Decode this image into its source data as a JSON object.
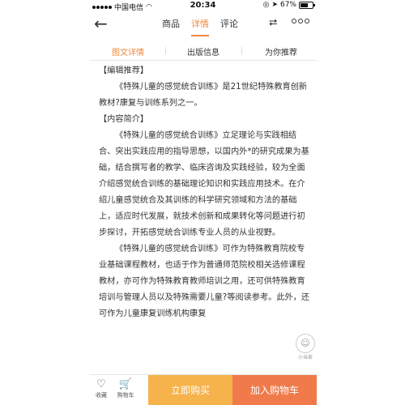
{
  "status_bar": {
    "carrier": "中国电信",
    "time": "20:34",
    "battery": "67%",
    "battery_level": 0.67
  },
  "nav": {
    "tabs": [
      "商品",
      "详情",
      "评论"
    ],
    "active_tab": "详情"
  },
  "sub_tabs": [
    "图文详情",
    "出版信息",
    "为你推荐"
  ],
  "content": {
    "editor_heading": "【编辑推荐】",
    "editor_text": "《特殊儿童的感觉统合训练》是21世纪特殊教育创新教材?康复与训练系列之一。",
    "intro_heading": "【内容简介】",
    "intro_p1": "《特殊儿童的感觉统合训练》立足理论与实践相结合、突出实践应用的指导思想，以国内外*的研究成果为基础，结合撰写者的教学、临床咨询及实践经验，较为全面介绍感觉统合训练的基础理论知识和实践应用技术。在介绍儿童感觉统合及其训练的科学研究领域和方法的基础上，适应时代发展，就技术创新和成果转化等问题进行初步探讨，开拓感觉统合训练专业人员的从业视野。",
    "intro_p2": "《特殊儿童的感觉统合训练》可作为特殊教育院校专业基础课程教材，也适于作为普通师范院校相关选修课程教材，亦可作为特殊教育教师培训之用，还可供特殊教育培训与管理人员以及特殊需要儿童?等阅读参考。此外，还可作为儿童康复训练机构康复"
  },
  "floating": {
    "label": "小当家"
  },
  "bottom_bar": {
    "favorite": "收藏",
    "cart": "购物车",
    "buy_now": "立即购买",
    "add_to_cart": "加入购物车"
  },
  "colors": {
    "accent": "#f08a3c",
    "buy_now_bg": "#f6b24b",
    "add_to_cart_bg": "#f07a4a"
  }
}
